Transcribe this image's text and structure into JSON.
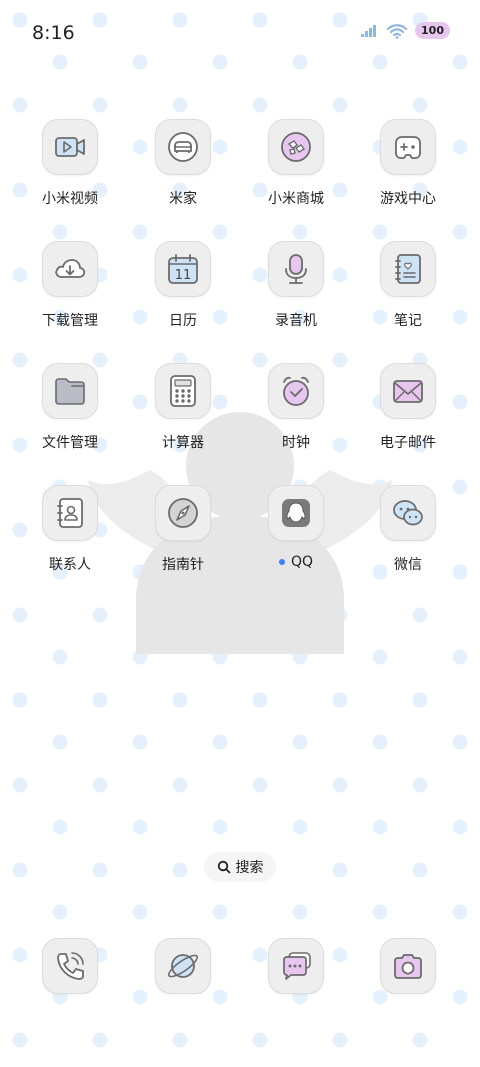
{
  "status_bar": {
    "time": "8:16",
    "battery": "100",
    "icons": [
      "signal-icon",
      "wifi-icon",
      "battery-icon"
    ]
  },
  "apps": [
    {
      "label": "小米视频",
      "icon": "video-icon"
    },
    {
      "label": "米家",
      "icon": "mijia-home-icon"
    },
    {
      "label": "小米商城",
      "icon": "mi-store-icon"
    },
    {
      "label": "游戏中心",
      "icon": "gamepad-icon"
    },
    {
      "label": "下载管理",
      "icon": "cloud-download-icon"
    },
    {
      "label": "日历",
      "icon": "calendar-icon",
      "date": "11"
    },
    {
      "label": "录音机",
      "icon": "microphone-icon"
    },
    {
      "label": "笔记",
      "icon": "notebook-icon"
    },
    {
      "label": "文件管理",
      "icon": "folder-icon"
    },
    {
      "label": "计算器",
      "icon": "calculator-icon"
    },
    {
      "label": "时钟",
      "icon": "alarm-clock-icon"
    },
    {
      "label": "电子邮件",
      "icon": "mail-icon"
    },
    {
      "label": "联系人",
      "icon": "contacts-icon"
    },
    {
      "label": "指南针",
      "icon": "compass-icon"
    },
    {
      "label": "QQ",
      "icon": "qq-penguin-icon",
      "has_update_dot": true
    },
    {
      "label": "微信",
      "icon": "wechat-icon"
    }
  ],
  "search": {
    "label": "搜索",
    "icon": "search-icon"
  },
  "dock": [
    {
      "icon": "phone-icon"
    },
    {
      "icon": "browser-planet-icon"
    },
    {
      "icon": "messages-icon"
    },
    {
      "icon": "camera-icon"
    }
  ],
  "colors": {
    "icon_tile": "#eeeeee",
    "icon_stroke": "#6b6b6b",
    "accent_blue": "#cfe3f7",
    "accent_pink": "#e7c6ef",
    "notification_dot": "#3b82f6"
  }
}
